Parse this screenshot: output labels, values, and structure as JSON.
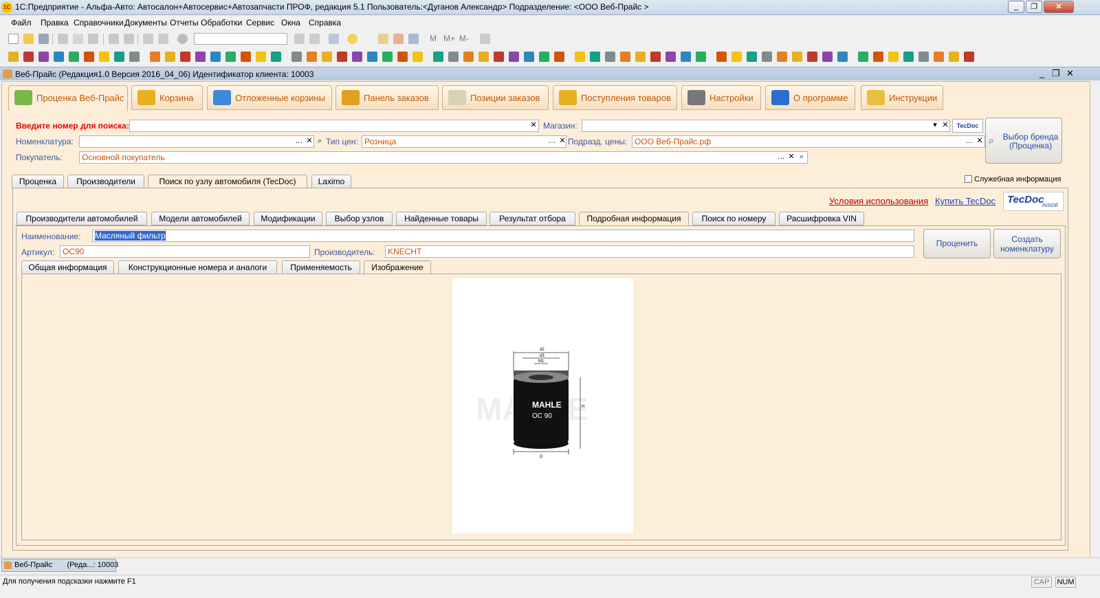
{
  "window": {
    "title": "1С:Предприятие - Альфа-Авто: Автосалон+Автосервис+Автозапчасти ПРОФ, редакция 5.1    Пользователь:<Дуганов Александр>    Подразделение: <ООО Веб-Прайс    >",
    "minimize": "_",
    "restore": "❐",
    "close": "✕"
  },
  "menu": [
    "Файл",
    "Правка",
    "Справочники",
    "Документы",
    "Отчеты",
    "Обработки",
    "Сервис",
    "Окна",
    "Справка"
  ],
  "toolbar2": {
    "m": "M",
    "mplus": "M+",
    "mminus": "M-"
  },
  "doc": {
    "title": "Веб-Прайс      (Редакция1.0 Версия 2016_04_06) Идентификатор клиента: 10003"
  },
  "main_tabs": [
    {
      "label": "Проценка Веб-Прайс",
      "icon": "price-icon",
      "color": "#7ab648"
    },
    {
      "label": "Корзина",
      "icon": "basket-icon",
      "color": "#e8b020"
    },
    {
      "label": "Отложенные корзины",
      "icon": "deferred-basket-icon",
      "color": "#3c8ad8"
    },
    {
      "label": "Панель заказов",
      "icon": "orders-panel-icon",
      "color": "#e0a020"
    },
    {
      "label": "Позиции заказов",
      "icon": "order-items-icon",
      "color": "#d9d0b8"
    },
    {
      "label": "Поступления товаров",
      "icon": "truck-icon",
      "color": "#e8b020"
    },
    {
      "label": "Настройки",
      "icon": "gear-icon",
      "color": "#777777"
    },
    {
      "label": "О программе",
      "icon": "info-icon",
      "color": "#2a6fd0"
    },
    {
      "label": "Инструкции",
      "icon": "instructions-icon",
      "color": "#e8c040"
    }
  ],
  "search": {
    "search_label": "Введите номер для поиска:",
    "search_value": "",
    "store_label": "Магазин:",
    "store_value": "",
    "nomenclature_label": "Номенклатура:",
    "nomenclature_value": "",
    "price_type_label": "Тип цен:",
    "price_type_value": "Розница",
    "price_dept_label": "Подразд. цены:",
    "price_dept_value": "ООО Веб-Прайс.рф",
    "buyer_label": "Покупатель:",
    "buyer_value": "Основной покупатель",
    "brand_button": "Выбор бренда (Проценка)",
    "tecdoc_small": "TecDoc"
  },
  "sub_tabs": [
    "Проценка",
    "Производители",
    "Поиск по узлу автомобиля (TecDoc)",
    "Laximo"
  ],
  "service_info": "Служебная информация",
  "links": {
    "terms": "Условия использования",
    "buy": "Купить TecDoc"
  },
  "tecdoc_logo": "TecDoc",
  "tecdoc_inside": "INSIDE",
  "tecdoc_tabs": [
    "Производители автомобилей",
    "Модели автомобилей",
    "Модификации",
    "Выбор узлов",
    "Найденные товары",
    "Результат отбора",
    "Подробная информация",
    "Поиск по номеру",
    "Расшифровка VIN"
  ],
  "details": {
    "name_label": "Наименование:",
    "name_value": "Масляный фильтр",
    "article_label": "Артикул:",
    "article_value": "OC90",
    "maker_label": "Производитель:",
    "maker_value": "KNECHT",
    "price_button": "Проценить",
    "create_button": "Создать номенклатуру"
  },
  "info_tabs": [
    "Общая информация",
    "Конструкционные номера и аналоги",
    "Применяемость",
    "Изображение"
  ],
  "image": {
    "brand_text": "MAHLE",
    "model_text": "OC 90",
    "watermark": "MAHLE",
    "dims": {
      "d2": "d2",
      "d3": "d3",
      "m1": "M1",
      "h": "H",
      "d": "D"
    }
  },
  "taskbar": {
    "item": "Веб-Прайс       (Реда...: 10003"
  },
  "status": {
    "hint": "Для получения подсказки нажмите F1",
    "cap": "CAP",
    "num": "NUM"
  }
}
